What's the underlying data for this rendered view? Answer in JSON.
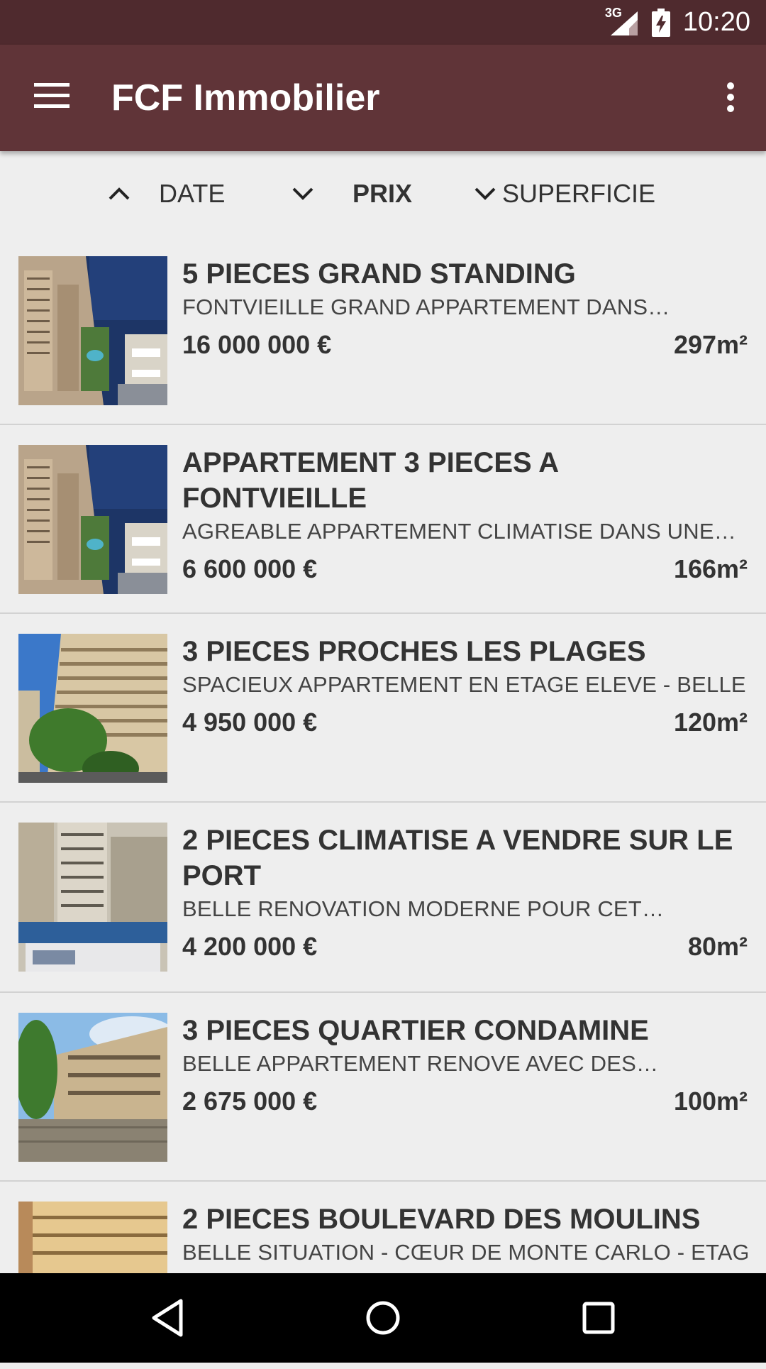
{
  "status_bar": {
    "network": "3G",
    "time": "10:20"
  },
  "app_bar": {
    "title": "FCF Immobilier",
    "menu_icon": "hamburger-menu-icon",
    "overflow_icon": "more-vertical-icon"
  },
  "sort": {
    "date": {
      "label": "DATE",
      "direction": "up"
    },
    "price": {
      "label": "PRIX",
      "direction": "down",
      "active": true
    },
    "area": {
      "label": "SUPERFICIE",
      "direction": "down"
    }
  },
  "listings": [
    {
      "title": "5 PIECES GRAND STANDING",
      "description": "FONTVIEILLE GRAND APPARTEMENT  DANS…",
      "price": "16 000 000 €",
      "area": "297m²"
    },
    {
      "title": "APPARTEMENT 3 PIECES A FONTVIEILLE",
      "description": "AGREABLE APPARTEMENT CLIMATISE DANS UNE…",
      "price": "6 600 000 €",
      "area": "166m²"
    },
    {
      "title": "3 PIECES PROCHES LES PLAGES",
      "description": "SPACIEUX APPARTEMENT EN ETAGE ELEVE - BELLE…",
      "price": "4 950 000 €",
      "area": "120m²"
    },
    {
      "title": "2 PIECES CLIMATISE A VENDRE SUR LE PORT",
      "description": "BELLE RENOVATION MODERNE POUR CET…",
      "price": "4 200 000 €",
      "area": "80m²"
    },
    {
      "title": "3 PIECES QUARTIER CONDAMINE",
      "description": "BELLE APPARTEMENT RENOVE AVEC DES…",
      "price": "2 675 000 €",
      "area": "100m²"
    },
    {
      "title": "2 PIECES BOULEVARD DES MOULINS",
      "description": "BELLE SITUATION  - CŒUR DE MONTE CARLO - ETAG…"
    }
  ],
  "colors": {
    "status_bar": "#4f2a2e",
    "app_bar": "#603438",
    "background": "#eeeeee",
    "text": "#333333"
  }
}
